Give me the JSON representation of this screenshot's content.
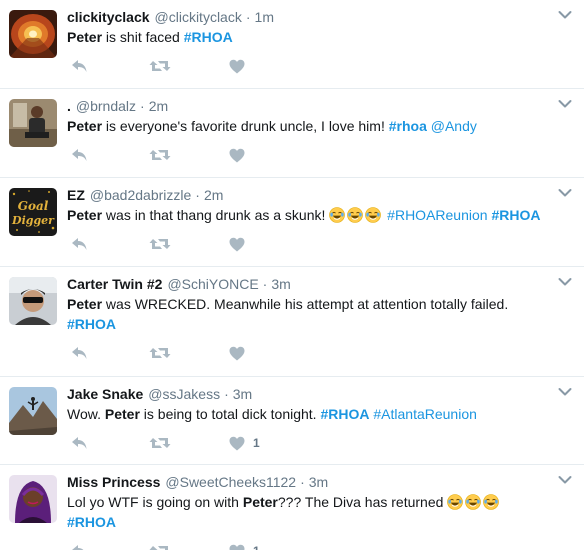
{
  "tweets": [
    {
      "name": "clickityclack",
      "handle": "@clickityclack",
      "time": "1m",
      "parts": [
        {
          "t": "b",
          "v": "Peter"
        },
        {
          "t": "s",
          "v": " is shit faced "
        },
        {
          "t": "tag",
          "v": "#RHOA",
          "strong": true
        }
      ],
      "likes": "",
      "avatar": "tunnel"
    },
    {
      "name": ".",
      "handle": "@brndalz",
      "time": "2m",
      "parts": [
        {
          "t": "b",
          "v": "Peter"
        },
        {
          "t": "s",
          "v": " is everyone's favorite drunk uncle, I love him! "
        },
        {
          "t": "tag",
          "v": "#rhoa",
          "strong": true
        },
        {
          "t": "s",
          "v": " "
        },
        {
          "t": "mention",
          "v": "@Andy"
        }
      ],
      "likes": "",
      "avatar": "man-sitting"
    },
    {
      "name": "EZ",
      "handle": "@bad2dabrizzle",
      "time": "2m",
      "parts": [
        {
          "t": "b",
          "v": "Peter"
        },
        {
          "t": "s",
          "v": " was in that thang drunk as a skunk! "
        },
        {
          "t": "emoji",
          "v": "😂"
        },
        {
          "t": "emoji",
          "v": "😂"
        },
        {
          "t": "emoji",
          "v": "😂"
        },
        {
          "t": "s",
          "v": " "
        },
        {
          "t": "tag",
          "v": "#RHOAReunion"
        },
        {
          "t": "s",
          "v": " "
        },
        {
          "t": "tag",
          "v": "#RHOA",
          "strong": true
        }
      ],
      "likes": "",
      "avatar": "goal-digger"
    },
    {
      "name": "Carter Twin #2",
      "handle": "@SchiYONCE",
      "time": "3m",
      "parts": [
        {
          "t": "b",
          "v": "Peter"
        },
        {
          "t": "s",
          "v": " was WRECKED. Meanwhile his attempt at attention totally failed. "
        },
        {
          "t": "tag",
          "v": "#RHOA",
          "strong": true
        }
      ],
      "likes": "",
      "avatar": "selfie-car"
    },
    {
      "name": "Jake Snake",
      "handle": "@ssJakess",
      "time": "3m",
      "parts": [
        {
          "t": "s",
          "v": "Wow. "
        },
        {
          "t": "b",
          "v": "Peter"
        },
        {
          "t": "s",
          "v": " is being to total dick tonight. "
        },
        {
          "t": "tag",
          "v": "#RHOA",
          "strong": true
        },
        {
          "t": "s",
          "v": " "
        },
        {
          "t": "tag",
          "v": "#AtlantaReunion"
        }
      ],
      "likes": "1",
      "avatar": "mountain"
    },
    {
      "name": "Miss Princess",
      "handle": "@SweetCheeks1122",
      "time": "3m",
      "parts": [
        {
          "t": "s",
          "v": "Lol yo WTF is going on with "
        },
        {
          "t": "b",
          "v": "Peter"
        },
        {
          "t": "s",
          "v": "??? The Diva has returned "
        },
        {
          "t": "emoji",
          "v": "😂"
        },
        {
          "t": "emoji",
          "v": "😂"
        },
        {
          "t": "emoji",
          "v": "😂"
        },
        {
          "t": "s",
          "v": " "
        },
        {
          "t": "tag",
          "v": "#RHOA",
          "strong": true
        }
      ],
      "likes": "1",
      "avatar": "woman-purple"
    }
  ],
  "colors": {
    "link": "#1b95e0",
    "icon": "#aab8c2",
    "meta": "#657786",
    "divider": "#e6ecf0"
  }
}
